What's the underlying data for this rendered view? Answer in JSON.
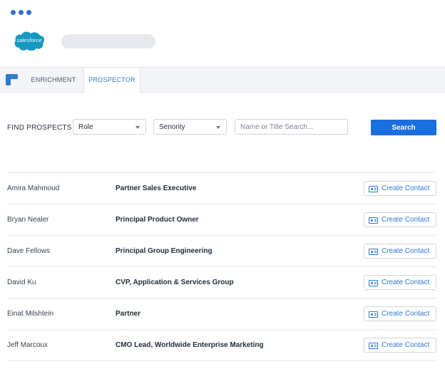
{
  "window": {
    "brand_logo_text": "salesforce"
  },
  "tabs": [
    {
      "label": "ENRICHMENT",
      "active": false
    },
    {
      "label": "PROSPECTOR",
      "active": true
    }
  ],
  "filters": {
    "label": "FIND PROSPECTS",
    "role": {
      "selected": "Role"
    },
    "seniority": {
      "selected": "Senority"
    },
    "search": {
      "placeholder": "Name or Title Search...",
      "value": ""
    },
    "search_button": "Search"
  },
  "results": [
    {
      "name": "Amira Mahmoud",
      "title": "Partner Sales Executive",
      "action": "Create Contact"
    },
    {
      "name": "Bryan Nealer",
      "title": "Principal Product Owner",
      "action": "Create Contact"
    },
    {
      "name": "Dave Fellows",
      "title": "Principal Group Engineering",
      "action": "Create Contact"
    },
    {
      "name": "David Ku",
      "title": "CVP, Application & Services Group",
      "action": "Create Contact"
    },
    {
      "name": "Einat Milshtein",
      "title": "Partner",
      "action": "Create Contact"
    },
    {
      "name": "Jeff Marcoux",
      "title": "CMO Lead, Worldwide Enterprise Marketing",
      "action": "Create Contact"
    }
  ],
  "colors": {
    "accent": "#1b6ee0",
    "link": "#2f78d0",
    "brand": "#1798c1"
  }
}
